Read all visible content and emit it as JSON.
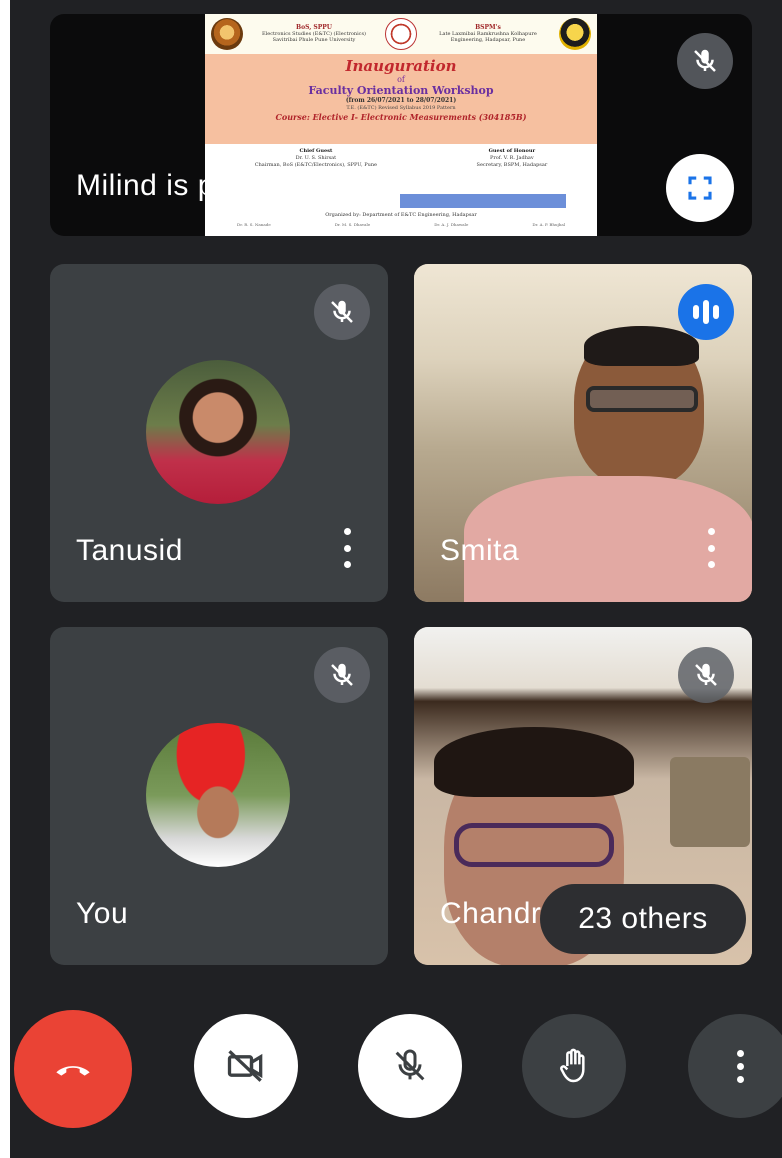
{
  "presentation": {
    "status_text": "Milind is presenting",
    "slide": {
      "left_org_1": "BoS, SPPU",
      "left_org_2": "Electronics Studies (E&TC) (Electronics)",
      "left_org_3": "Savitribai Phule Pune University",
      "right_org_1": "BSPM's",
      "right_org_2": "Late Laxmibai Ramkrushna Kolhapure",
      "right_org_3": "Engineering, Hadapsar, Pune",
      "title": "Inauguration",
      "of": "of",
      "workshop": "Faculty Orientation Workshop",
      "dates": "(from 26/07/2021 to 28/07/2021)",
      "program": "T.E. (E&TC) Revised Syllabus 2019 Pattern",
      "course": "Course: Elective I- Electronic Measurements (304185B)",
      "chief_guest_role": "Chief Guest",
      "chief_guest_name": "Dr. U. S. Shirsat",
      "chief_guest_title": "Chairman, BoS (E&TC/Electronics), SPPU, Pune",
      "guest_of_honour_role": "Guest of Honour",
      "guest_of_honour_name": "Prof. V. R. Jadhav",
      "guest_of_honour_title": "Secretary, BSPM, Hadapsar",
      "organizer": "Organized by: Department of E&TC Engineering, Hadapsar",
      "coordinators": [
        "Dr. R. S. Nanade",
        "Dr. M. S. Dhavale",
        "Dr. A. J. Dhawale",
        "Dr. A. P. Bhujbal"
      ]
    }
  },
  "participants": [
    {
      "name": "Tanusid",
      "muted": true,
      "avatar": "Tanusid profile photo"
    },
    {
      "name": "Smita",
      "muted": false,
      "speaking": true
    },
    {
      "name": "You",
      "muted": true,
      "avatar": "Your profile photo"
    },
    {
      "name": "Chandra",
      "muted": true
    }
  ],
  "others_label": "23 others",
  "controls": {
    "end_call": "End call",
    "camera": "Camera off",
    "microphone": "Microphone off",
    "raise_hand": "Raise hand",
    "more": "More options"
  },
  "colors": {
    "background": "#202124",
    "tile": "#3c4043",
    "end_call": "#ea4335",
    "speaking_indicator": "#1a73e8"
  },
  "icons": [
    "mic-off-icon",
    "fullscreen-icon",
    "more-vert-icon",
    "speaking-indicator-icon",
    "end-call-icon",
    "videocam-off-icon",
    "hand-icon"
  ]
}
